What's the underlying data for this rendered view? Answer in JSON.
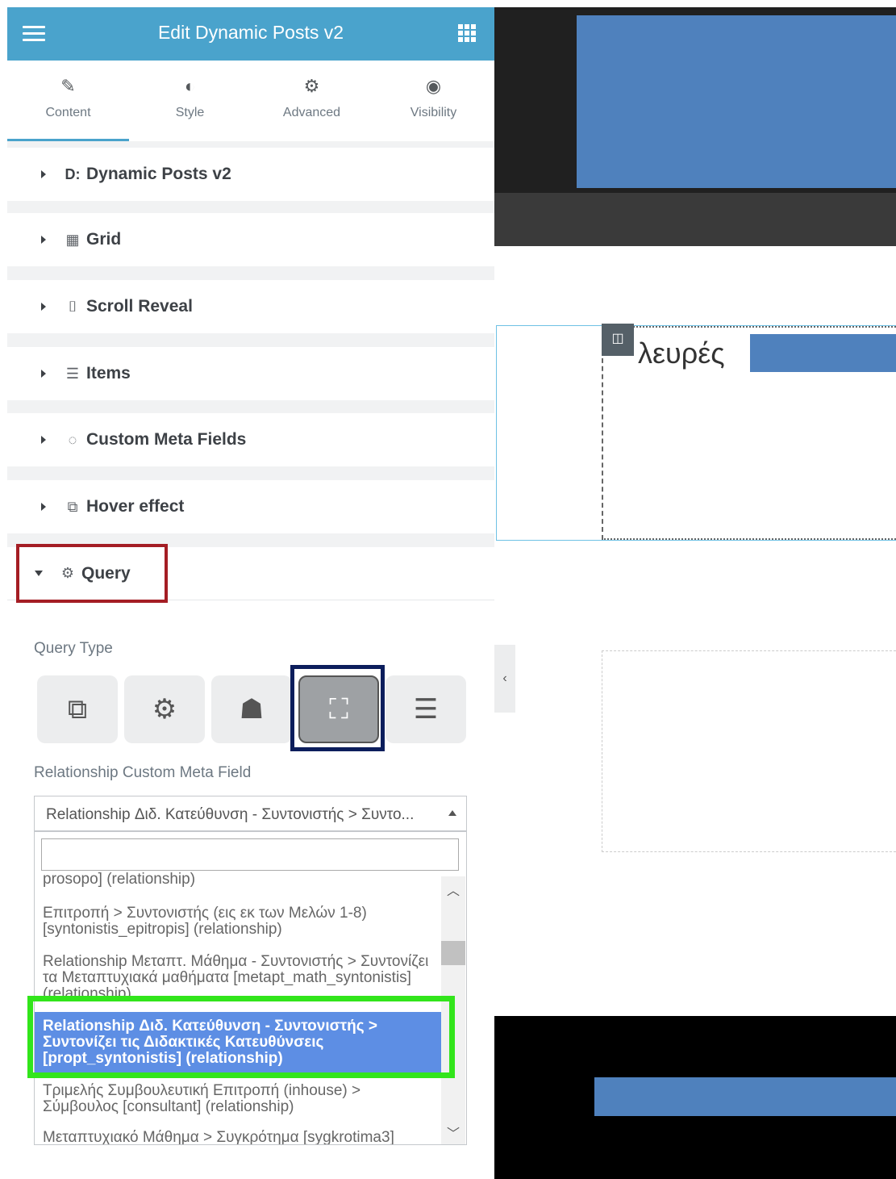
{
  "panel": {
    "title": "Edit Dynamic Posts v2",
    "tabs": [
      {
        "label": "Content",
        "icon": "pencil-icon"
      },
      {
        "label": "Style",
        "icon": "half-circle-icon"
      },
      {
        "label": "Advanced",
        "icon": "gear-icon"
      },
      {
        "label": "Visibility",
        "icon": "eye-icon"
      }
    ],
    "sections": [
      {
        "label": "Dynamic Posts v2",
        "icon": "D:"
      },
      {
        "label": "Grid",
        "icon": "grid-icon"
      },
      {
        "label": "Scroll Reveal",
        "icon": "mouse-icon"
      },
      {
        "label": "Items",
        "icon": "list-tree-icon"
      },
      {
        "label": "Custom Meta Fields",
        "icon": "check-circle-icon"
      },
      {
        "label": "Hover effect",
        "icon": "hover-icon"
      },
      {
        "label": "Query",
        "icon": "query-gear-icon"
      }
    ],
    "query": {
      "type_label": "Query Type",
      "types": [
        "copy-icon",
        "gears-icon",
        "sitemap-icon",
        "relationship-icon",
        "list-icon"
      ],
      "active_type": 3,
      "relationship_label": "Relationship Custom Meta Field",
      "selected_value": "Relationship Διδ. Κατεύθυνση - Συντονιστής > Συντο...",
      "search_value": "",
      "options": [
        "prosopo] (relationship)",
        "Επιτροπή > Συντονιστής (εις εκ των Μελών 1-8) [syntonistis_epitropis] (relationship)",
        "Relationship Μεταπτ. Μάθημα - Συντονιστής > Συντονίζει τα Μεταπτυχιακά μαθήματα [metapt_math_syntonistis] (relationship)",
        "Relationship Διδ. Κατεύθυνση - Συντονιστής > Συντονίζει τις Διδακτικές Κατευθύνσεις [propt_syntonistis] (relationship)",
        "Τριμελής Συμβουλευτική Επιτροπή (inhouse) > Σύμβουλος [consultant] (relationship)",
        "Μεταπτυχιακό Μάθημα > Συγκρότημα [sygkrotima3]"
      ],
      "selected_option": 3
    }
  },
  "preview": {
    "heading_fragment": "λευρές"
  },
  "colors": {
    "header_bg": "#4aa3cc",
    "highlight_query": "#a41d24",
    "highlight_type": "#0c1e5c",
    "highlight_option": "#32e51b",
    "selected_option_bg": "#5d8ee4",
    "placeholder_blue": "#4f81bd"
  }
}
